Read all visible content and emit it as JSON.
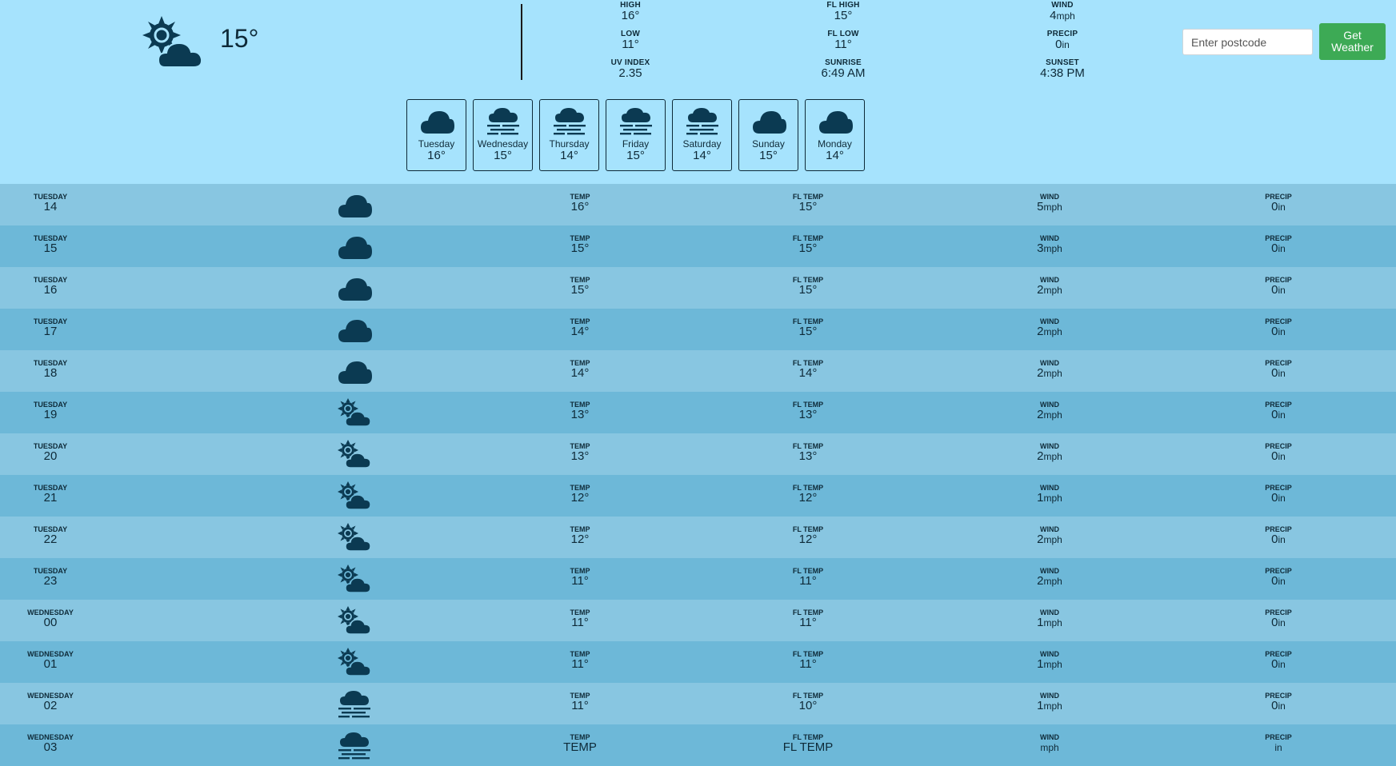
{
  "current": {
    "icon": "sun-cloud-icon",
    "temp": "15°",
    "high_label": "HIGH",
    "high": "16°",
    "low_label": "LOW",
    "low": "11°",
    "uv_label": "UV INDEX",
    "uv": "2.35",
    "fl_high_label": "FL HIGH",
    "fl_high": "15°",
    "fl_low_label": "FL LOW",
    "fl_low": "11°",
    "sunrise_label": "SUNRISE",
    "sunrise": "6:49 AM",
    "wind_label": "WIND",
    "wind": "4",
    "wind_unit": "mph",
    "precip_label": "PRECIP",
    "precip": "0",
    "precip_unit": "in",
    "sunset_label": "SUNSET",
    "sunset": "4:38 PM"
  },
  "search": {
    "placeholder": "Enter postcode",
    "button_label": "Get Weather"
  },
  "daily": [
    {
      "day": "Tuesday",
      "temp": "16°",
      "icon": "cloud-icon"
    },
    {
      "day": "Wednesday",
      "temp": "15°",
      "icon": "fog-icon"
    },
    {
      "day": "Thursday",
      "temp": "14°",
      "icon": "fog-icon"
    },
    {
      "day": "Friday",
      "temp": "15°",
      "icon": "fog-icon"
    },
    {
      "day": "Saturday",
      "temp": "14°",
      "icon": "fog-icon"
    },
    {
      "day": "Sunday",
      "temp": "15°",
      "icon": "cloud-icon"
    },
    {
      "day": "Monday",
      "temp": "14°",
      "icon": "cloud-icon"
    }
  ],
  "hourly_labels": {
    "temp": "TEMP",
    "fl_temp": "FL TEMP",
    "wind": "WIND",
    "precip": "PRECIP",
    "wind_unit": "mph",
    "precip_unit": "in"
  },
  "hourly": [
    {
      "day": "TUESDAY",
      "hour": "14",
      "icon": "cloud-icon",
      "temp": "16°",
      "fl_temp": "15°",
      "wind": "5",
      "precip": "0"
    },
    {
      "day": "TUESDAY",
      "hour": "15",
      "icon": "cloud-icon",
      "temp": "15°",
      "fl_temp": "15°",
      "wind": "3",
      "precip": "0"
    },
    {
      "day": "TUESDAY",
      "hour": "16",
      "icon": "cloud-icon",
      "temp": "15°",
      "fl_temp": "15°",
      "wind": "2",
      "precip": "0"
    },
    {
      "day": "TUESDAY",
      "hour": "17",
      "icon": "cloud-icon",
      "temp": "14°",
      "fl_temp": "15°",
      "wind": "2",
      "precip": "0"
    },
    {
      "day": "TUESDAY",
      "hour": "18",
      "icon": "cloud-icon",
      "temp": "14°",
      "fl_temp": "14°",
      "wind": "2",
      "precip": "0"
    },
    {
      "day": "TUESDAY",
      "hour": "19",
      "icon": "sun-cloud-icon",
      "temp": "13°",
      "fl_temp": "13°",
      "wind": "2",
      "precip": "0"
    },
    {
      "day": "TUESDAY",
      "hour": "20",
      "icon": "sun-cloud-icon",
      "temp": "13°",
      "fl_temp": "13°",
      "wind": "2",
      "precip": "0"
    },
    {
      "day": "TUESDAY",
      "hour": "21",
      "icon": "sun-cloud-icon",
      "temp": "12°",
      "fl_temp": "12°",
      "wind": "1",
      "precip": "0"
    },
    {
      "day": "TUESDAY",
      "hour": "22",
      "icon": "sun-cloud-icon",
      "temp": "12°",
      "fl_temp": "12°",
      "wind": "2",
      "precip": "0"
    },
    {
      "day": "TUESDAY",
      "hour": "23",
      "icon": "sun-cloud-icon",
      "temp": "11°",
      "fl_temp": "11°",
      "wind": "2",
      "precip": "0"
    },
    {
      "day": "WEDNESDAY",
      "hour": "00",
      "icon": "sun-cloud-icon",
      "temp": "11°",
      "fl_temp": "11°",
      "wind": "1",
      "precip": "0"
    },
    {
      "day": "WEDNESDAY",
      "hour": "01",
      "icon": "sun-cloud-icon",
      "temp": "11°",
      "fl_temp": "11°",
      "wind": "1",
      "precip": "0"
    },
    {
      "day": "WEDNESDAY",
      "hour": "02",
      "icon": "fog-icon",
      "temp": "11°",
      "fl_temp": "10°",
      "wind": "1",
      "precip": "0"
    },
    {
      "day": "WEDNESDAY",
      "hour": "03",
      "icon": "fog-icon",
      "temp": "TEMP",
      "fl_temp": "FL TEMP",
      "wind": "",
      "precip": ""
    }
  ]
}
